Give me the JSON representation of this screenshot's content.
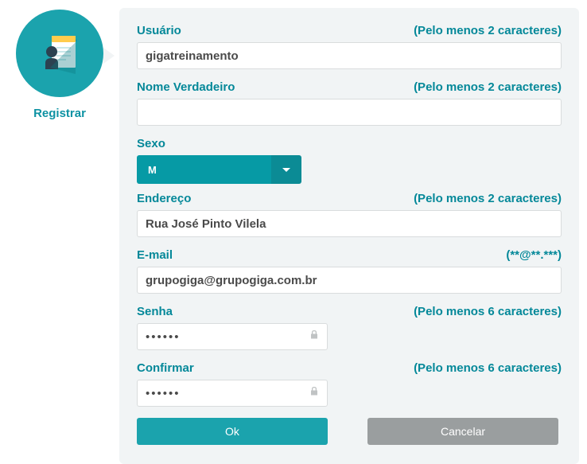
{
  "sidebar": {
    "label": "Registrar"
  },
  "form": {
    "usuario": {
      "label": "Usuário",
      "hint": "(Pelo menos 2 caracteres)",
      "value": "gigatreinamento"
    },
    "nome": {
      "label": "Nome Verdadeiro",
      "hint": "(Pelo menos 2 caracteres)",
      "value": ""
    },
    "sexo": {
      "label": "Sexo",
      "value": "M"
    },
    "endereco": {
      "label": "Endereço",
      "hint": "(Pelo menos 2 caracteres)",
      "value": "Rua José Pinto Vilela"
    },
    "email": {
      "label": "E-mail",
      "hint": "(**@**.***)",
      "value": "grupogiga@grupogiga.com.br"
    },
    "senha": {
      "label": "Senha",
      "hint": "(Pelo menos 6 caracteres)",
      "value": "••••••"
    },
    "confirmar": {
      "label": "Confirmar",
      "hint": "(Pelo menos 6 caracteres)",
      "value": "••••••"
    },
    "buttons": {
      "ok": "Ok",
      "cancel": "Cancelar"
    }
  }
}
